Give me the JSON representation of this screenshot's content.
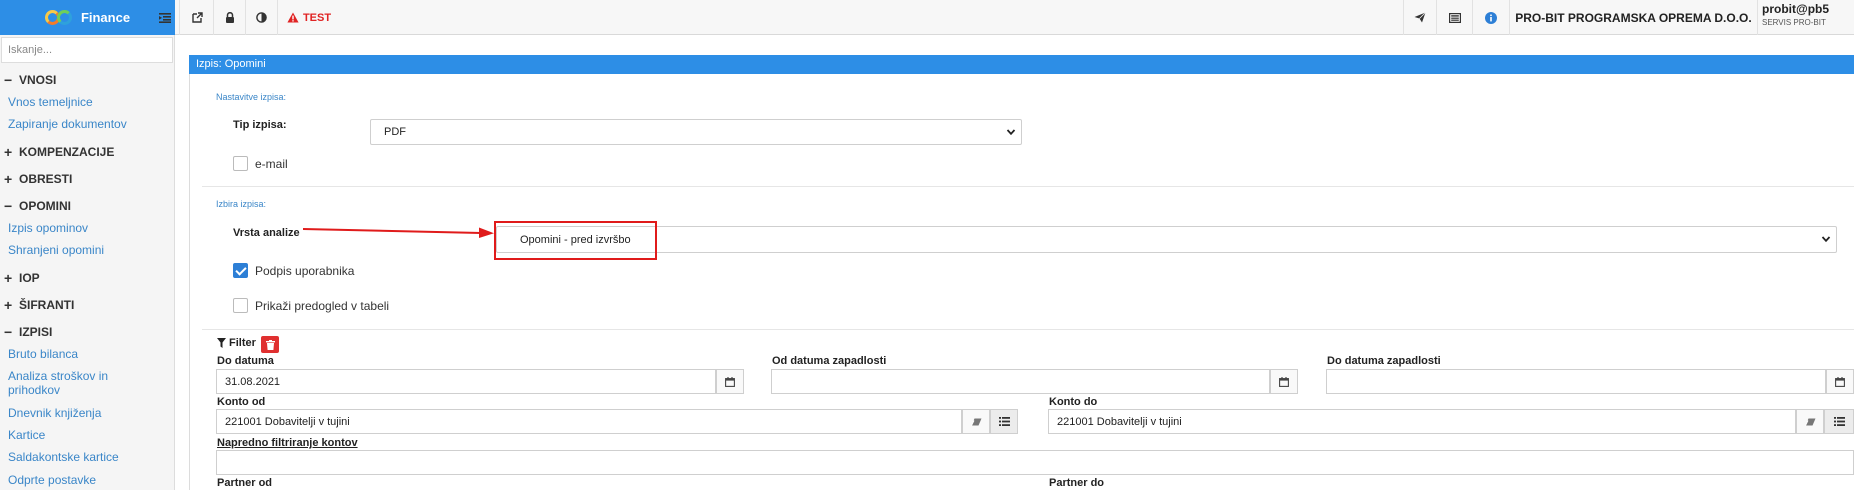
{
  "app": {
    "name": "Finance"
  },
  "toolbar": {
    "test_label": "TEST"
  },
  "header": {
    "company": "PRO-BIT PROGRAMSKA OPREMA D.O.O.",
    "user": "probit@pb5",
    "user_sub": "SERVIS PRO-BIT"
  },
  "sidebar": {
    "search_placeholder": "Iskanje...",
    "sections": [
      {
        "label": "VNOSI",
        "symbol": "−"
      },
      {
        "label": "KOMPENZACIJE",
        "symbol": "+"
      },
      {
        "label": "OBRESTI",
        "symbol": "+"
      },
      {
        "label": "OPOMINI",
        "symbol": "−"
      },
      {
        "label": "IOP",
        "symbol": "+"
      },
      {
        "label": "ŠIFRANTI",
        "symbol": "+"
      },
      {
        "label": "IZPISI",
        "symbol": "−"
      }
    ],
    "links": {
      "vnos_temeljnice": "Vnos temeljnice",
      "zapiranje": "Zapiranje dokumentov",
      "izpis_opominov": "Izpis opominov",
      "shranjeni_opomini": "Shranjeni opomini",
      "bruto_bilanca": "Bruto bilanca",
      "analiza_1": "Analiza stroškov in",
      "analiza_2": "prihodkov",
      "dnevnik": "Dnevnik knjiženja",
      "kartice": "Kartice",
      "saldakontske": "Saldakontske kartice",
      "odprte": "Odprte postavke"
    }
  },
  "panel": {
    "title": "Izpis: Opomini",
    "settings": {
      "heading": "Nastavitve izpisa:",
      "tip_label": "Tip izpisa:",
      "tip_value": "PDF",
      "email_label": "e-mail",
      "email_checked": false
    },
    "selection": {
      "heading": "Izbira izpisa:",
      "vrsta_label": "Vrsta analize",
      "vrsta_value": "Opomini - pred izvršbo",
      "podpis_label": "Podpis uporabnika",
      "podpis_checked": true,
      "predogled_label": "Prikaži predogled v tabeli",
      "predogled_checked": false
    },
    "filter": {
      "title": "Filter",
      "do_datuma_label": "Do datuma",
      "do_datuma_value": "31.08.2021",
      "od_zapadlosti_label": "Od datuma zapadlosti",
      "od_zapadlosti_value": "",
      "do_zapadlosti_label": "Do datuma zapadlosti",
      "do_zapadlosti_value": "",
      "konto_od_label": "Konto od",
      "konto_od_value": "221001 Dobavitelji v tujini",
      "konto_do_label": "Konto do",
      "konto_do_value": "221001 Dobavitelji v tujini",
      "napredno_label": "Napredno filtriranje kontov",
      "partner_od_label": "Partner od",
      "partner_do_label": "Partner do"
    }
  },
  "colors": {
    "accent": "#2d8ee6",
    "highlight": "#e01b1b",
    "link": "#3a86c8"
  }
}
